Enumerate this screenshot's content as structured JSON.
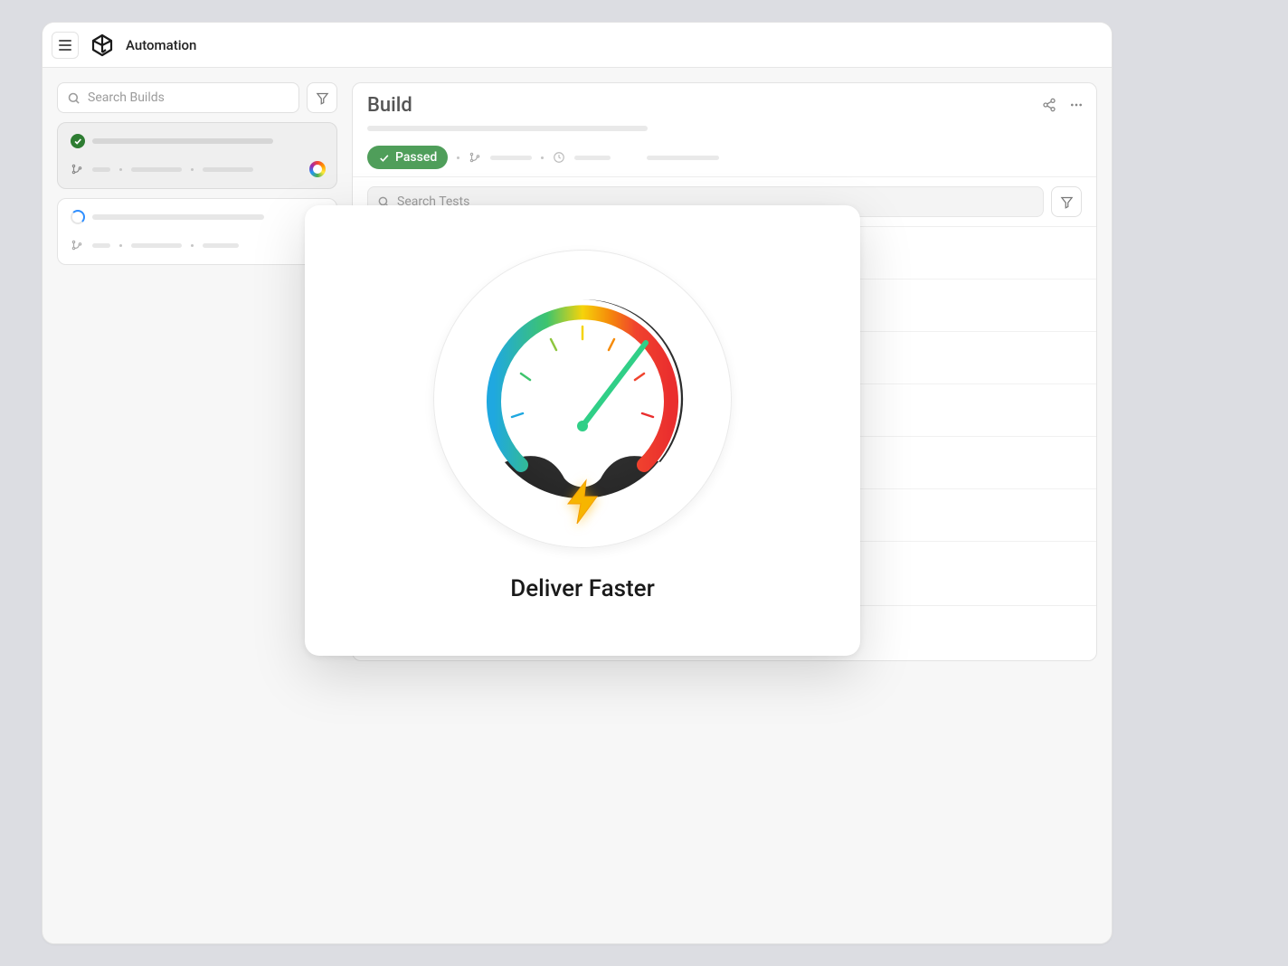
{
  "header": {
    "title": "Automation"
  },
  "sidebar": {
    "search_placeholder": "Search Builds"
  },
  "main": {
    "title": "Build",
    "status_label": "Passed",
    "tests_search_placeholder": "Search Tests"
  },
  "modal": {
    "heading": "Deliver Faster"
  },
  "icons": {
    "search": "search",
    "filter": "filter",
    "share": "share",
    "more": "more",
    "branch": "branch",
    "clock": "clock",
    "check": "check",
    "apple": "",
    "lightning": "lightning"
  }
}
